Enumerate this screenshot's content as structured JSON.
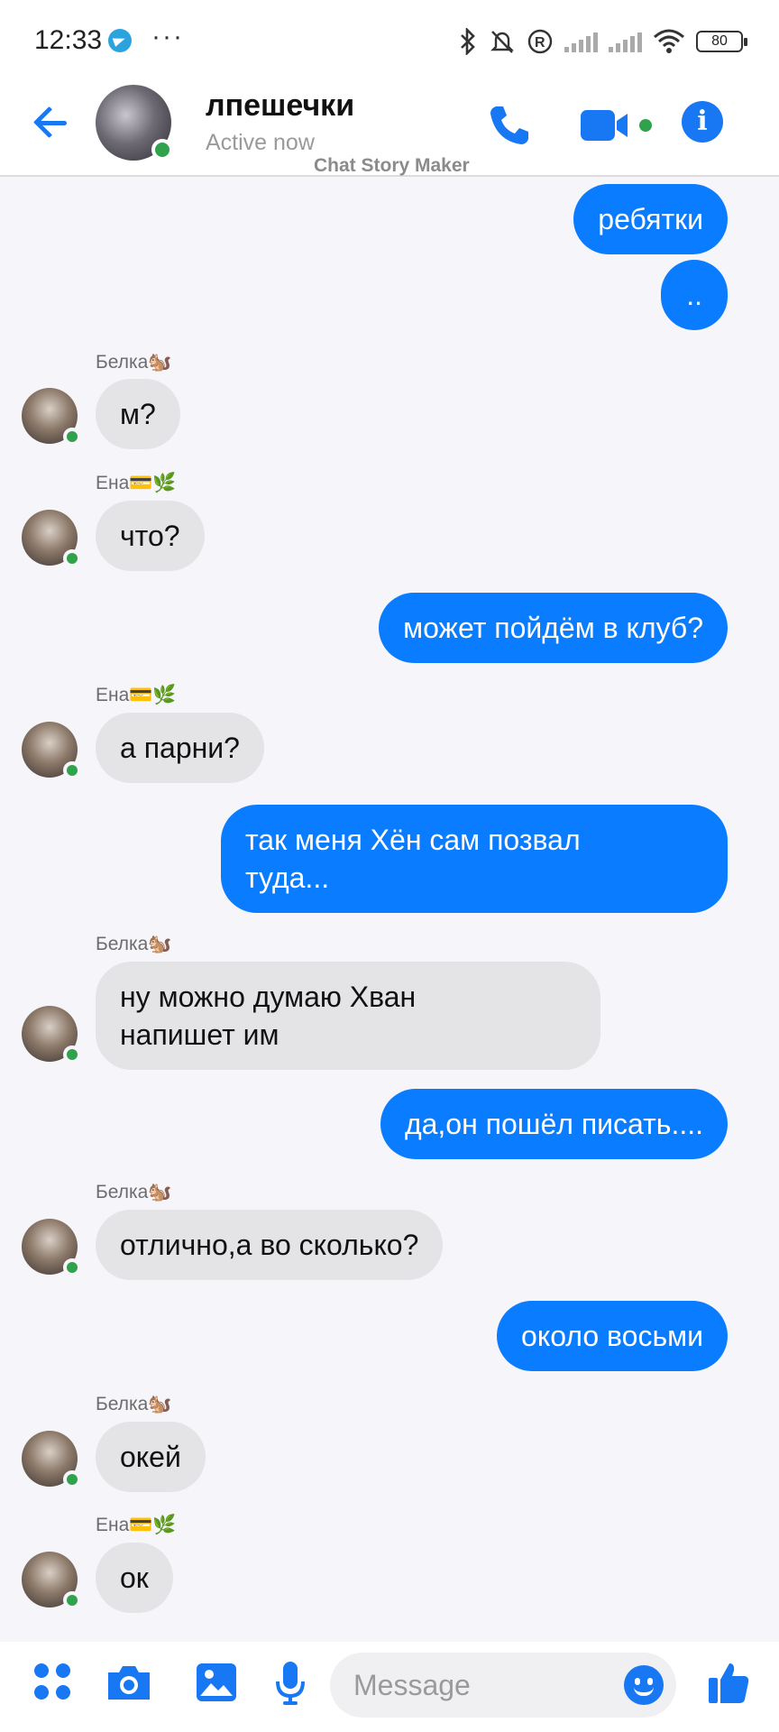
{
  "status_bar": {
    "time": "12:33",
    "more": "···",
    "battery": "80"
  },
  "header": {
    "title": "лпешечки",
    "subtitle": "Active now",
    "watermark": "Chat Story Maker"
  },
  "messages": [
    {
      "id": 1,
      "dir": "out",
      "text": "ребятки"
    },
    {
      "id": 2,
      "dir": "out",
      "text": ".."
    },
    {
      "id": 3,
      "dir": "in",
      "sender": "Белка🐿️",
      "text": "м?"
    },
    {
      "id": 4,
      "dir": "in",
      "sender": "Ена💳🌿",
      "text": "что?"
    },
    {
      "id": 5,
      "dir": "out",
      "text": "может пойдём в клуб?"
    },
    {
      "id": 6,
      "dir": "in",
      "sender": "Ена💳🌿",
      "text": "а парни?"
    },
    {
      "id": 7,
      "dir": "out",
      "text": "так меня Хён сам позвал\nтуда..."
    },
    {
      "id": 8,
      "dir": "in",
      "sender": "Белка🐿️",
      "text": "ну можно думаю Хван\nнапишет им"
    },
    {
      "id": 9,
      "dir": "out",
      "text": "да,он пошёл писать...."
    },
    {
      "id": 10,
      "dir": "in",
      "sender": "Белка🐿️",
      "text": "отлично,а во сколько?"
    },
    {
      "id": 11,
      "dir": "out",
      "text": "около восьми"
    },
    {
      "id": 12,
      "dir": "in",
      "sender": "Белка🐿️",
      "text": "окей"
    },
    {
      "id": 13,
      "dir": "in",
      "sender": "Ена💳🌿",
      "text": "ок"
    }
  ],
  "composer": {
    "placeholder": "Message",
    "icons": [
      "apps-icon",
      "camera-icon",
      "gallery-icon",
      "microphone-icon",
      "emoji-icon",
      "like-icon"
    ]
  },
  "colors": {
    "accent": "#0a7cff",
    "incoming_bubble": "#e4e4e7",
    "online": "#31a24c"
  }
}
